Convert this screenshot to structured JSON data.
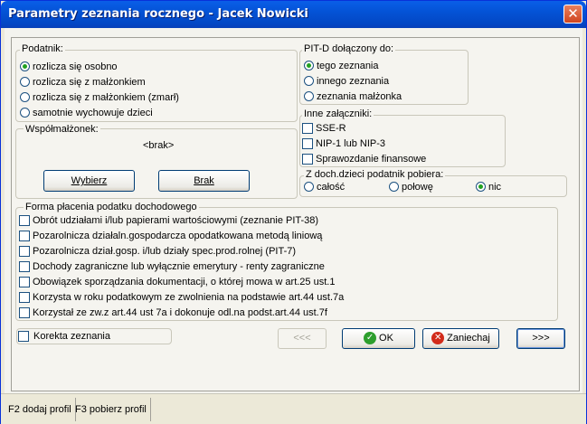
{
  "window": {
    "title": "Parametry zeznania rocznego - Jacek Nowicki",
    "close_glyph": "✕"
  },
  "podatnik": {
    "label": "Podatnik:",
    "options": [
      {
        "label": "rozlicza się osobno",
        "selected": true
      },
      {
        "label": "rozlicza się z małżonkiem",
        "selected": false
      },
      {
        "label": "rozlicza się z małżonkiem (zmarł)",
        "selected": false
      },
      {
        "label": "samotnie wychowuje dzieci",
        "selected": false
      }
    ]
  },
  "wspolmalzonek": {
    "label": "Współmałżonek:",
    "value": "<brak>",
    "select_button": "Wybierz",
    "none_button": "Brak"
  },
  "pitd": {
    "label": "PIT-D dołączony do:",
    "options": [
      {
        "label": "tego zeznania",
        "selected": true
      },
      {
        "label": "innego zeznania",
        "selected": false
      },
      {
        "label": "zeznania małżonka",
        "selected": false
      }
    ]
  },
  "inne": {
    "label": "Inne załączniki:",
    "items": [
      {
        "label": "SSE-R",
        "checked": false
      },
      {
        "label": "NIP-1 lub NIP-3",
        "checked": false
      },
      {
        "label": "Sprawozdanie finansowe",
        "checked": false
      }
    ]
  },
  "dzieci": {
    "label": "Z doch.dzieci podatnik pobiera:",
    "options": [
      {
        "label": "całość",
        "selected": false
      },
      {
        "label": "połowę",
        "selected": false
      },
      {
        "label": "nic",
        "selected": true
      }
    ]
  },
  "forma": {
    "label": "Forma płacenia podatku dochodowego",
    "items": [
      {
        "label": "Obrót udziałami i/lub papierami wartościowymi (zeznanie PIT-38)",
        "checked": false
      },
      {
        "label": "Pozarolnicza działaln.gospodarcza opodatkowana metodą liniową",
        "checked": false
      },
      {
        "label": "Pozarolnicza dział.gosp. i/lub działy spec.prod.rolnej (PIT-7)",
        "checked": false
      },
      {
        "label": "Dochody zagraniczne lub wyłącznie emerytury - renty zagraniczne",
        "checked": false
      },
      {
        "label": "Obowiązek sporządzania dokumentacji, o której mowa w art.25 ust.1",
        "checked": false
      },
      {
        "label": "Korzysta w roku podatkowym ze zwolnienia na podstawie art.44 ust.7a",
        "checked": false
      },
      {
        "label": "Korzystał ze zw.z art.44 ust 7a i dokonuje odl.na podst.art.44 ust.7f",
        "checked": false
      }
    ]
  },
  "korekta": {
    "label": "Korekta zeznania",
    "checked": false
  },
  "buttons": {
    "prev": "<<<",
    "ok": "OK",
    "cancel": "Zaniechaj",
    "next": ">>>"
  },
  "statusbar": {
    "f2": "F2 dodaj profil",
    "f3": "F3 pobierz profil"
  }
}
